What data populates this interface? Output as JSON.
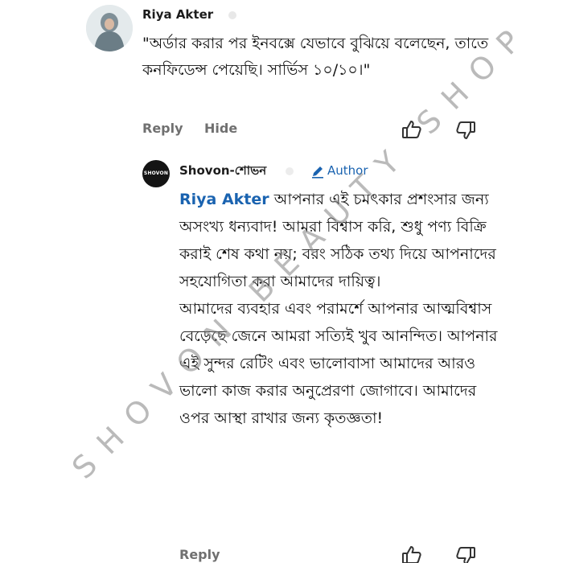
{
  "comment": {
    "author": "Riya Akter",
    "text": "\"অর্ডার করার পর ইনবক্সে যেভাবে বুঝিয়ে বলেছেন, তাতে কনফিডেন্স পেয়েছি। সার্ভিস ১০/১০।\"",
    "actions": {
      "reply_label": "Reply",
      "hide_label": "Hide",
      "like_icon": "thumbs-up-icon",
      "dislike_icon": "thumbs-down-icon"
    }
  },
  "reply": {
    "author": "Shovon-শোভন",
    "avatar_text": "SHOVON",
    "badge_label": "Author",
    "badge_icon": "pencil-icon",
    "mention": "Riya Akter",
    "text": " আপনার এই চমৎকার প্রশংসার জন্য অসংখ্য ধন্যবাদ! আমরা বিশ্বাস করি, শুধু পণ্য বিক্রি করাই শেষ কথা নয়; বরং সঠিক তথ্য দিয়ে আপনাদের সহযোগিতা করা আমাদের দায়িত্ব।",
    "text2": "আমাদের ব্যবহার এবং পরামর্শে আপনার আত্মবিশ্বাস বেড়েছে জেনে আমরা সত্যিই খুব আনন্দিত। আপনার এই সুন্দর রেটিং এবং ভালোবাসা আমাদের আরও ভালো কাজ করার অনুপ্রেরণা জোগাবে। আমাদের ওপর আস্থা রাখার জন্য কৃতজ্ঞতা!",
    "actions": {
      "reply_label": "Reply"
    }
  },
  "watermark": "SHOVON BEAUTY SHOP",
  "colors": {
    "link_blue": "#1a63b0",
    "action_gray": "#707070",
    "text": "#111111"
  }
}
